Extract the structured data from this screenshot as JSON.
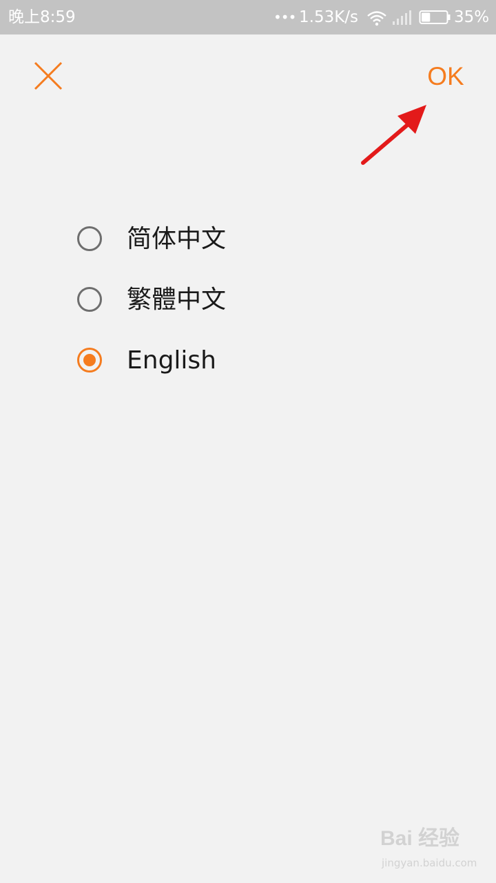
{
  "status_bar": {
    "time": "晚上8:59",
    "dots": "•••",
    "speed": "1.53K/s",
    "battery_percent": "35%",
    "battery_level": 0.35,
    "icons": [
      "wifi-icon",
      "signal-icon",
      "battery-icon"
    ]
  },
  "header": {
    "close_icon": "close-icon",
    "ok_label": "OK"
  },
  "languages": [
    {
      "label": "简体中文",
      "selected": false
    },
    {
      "label": "繁體中文",
      "selected": false
    },
    {
      "label": "English",
      "selected": true
    }
  ],
  "watermark": {
    "main": "Bai 经验",
    "sub": "jingyan.baidu.com"
  },
  "colors": {
    "accent": "#f57c1f",
    "annotation_arrow": "#e31a1a",
    "background": "#f2f2f2",
    "status_bar": "#c3c3c3",
    "radio_unchecked": "#6e6e6e"
  }
}
